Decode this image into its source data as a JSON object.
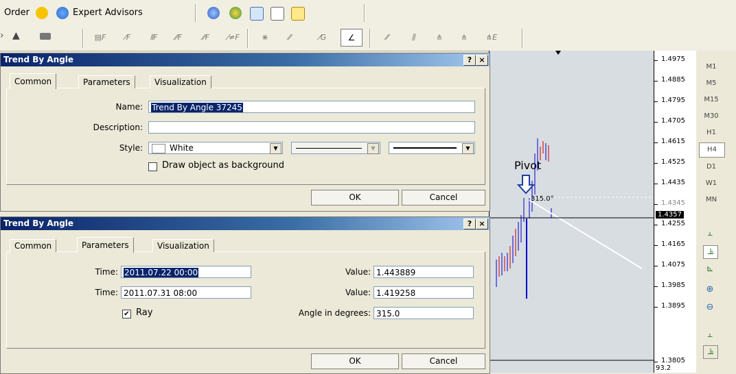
{
  "toolbar": {
    "order_label": "Order",
    "expert_advisors_label": "Expert Advisors"
  },
  "dialog1": {
    "title": "Trend By Angle",
    "help_btn": "?",
    "close_btn": "×",
    "tabs": [
      "Common",
      "Parameters",
      "Visualization"
    ],
    "name_label": "Name:",
    "name_value": "Trend By Angle 37245",
    "description_label": "Description:",
    "description_value": "",
    "style_label": "Style:",
    "style_color": "White",
    "background_checkbox_label": "Draw object as background",
    "ok_label": "OK",
    "cancel_label": "Cancel"
  },
  "dialog2": {
    "title": "Trend By Angle",
    "help_btn": "?",
    "close_btn": "×",
    "tabs": [
      "Common",
      "Parameters",
      "Visualization"
    ],
    "time_label": "Time:",
    "time1_value": "2011.07.22 00:00",
    "time2_value": "2011.07.31 08:00",
    "value_label": "Value:",
    "value1": "1.443889",
    "value2": "1.419258",
    "ray_label": "Ray",
    "ray_checked": true,
    "angle_label": "Angle in degrees:",
    "angle_value": "315.0",
    "ok_label": "OK",
    "cancel_label": "Cancel"
  },
  "chart": {
    "pivot_label": "Pivot",
    "angle_annotation": "315.0°",
    "current_price": "1.4357",
    "price_labels": [
      "1.4975",
      "1.4885",
      "1.4795",
      "1.4705",
      "1.4615",
      "1.4525",
      "1.4435",
      "1.4345",
      "1.4255",
      "1.4165",
      "1.4075",
      "1.3985",
      "1.3895",
      "1.3805"
    ],
    "indicator_value": "93.2",
    "timeframes": [
      "M1",
      "M5",
      "M15",
      "M30",
      "H1",
      "H4",
      "D1",
      "W1",
      "MN"
    ],
    "active_timeframe": "H4"
  },
  "colors": {
    "title_gradient_start": "#0a246a",
    "chart_bg": "#d8dde2",
    "bull_candle": "#0000cc",
    "bear_candle": "#cc0000"
  }
}
